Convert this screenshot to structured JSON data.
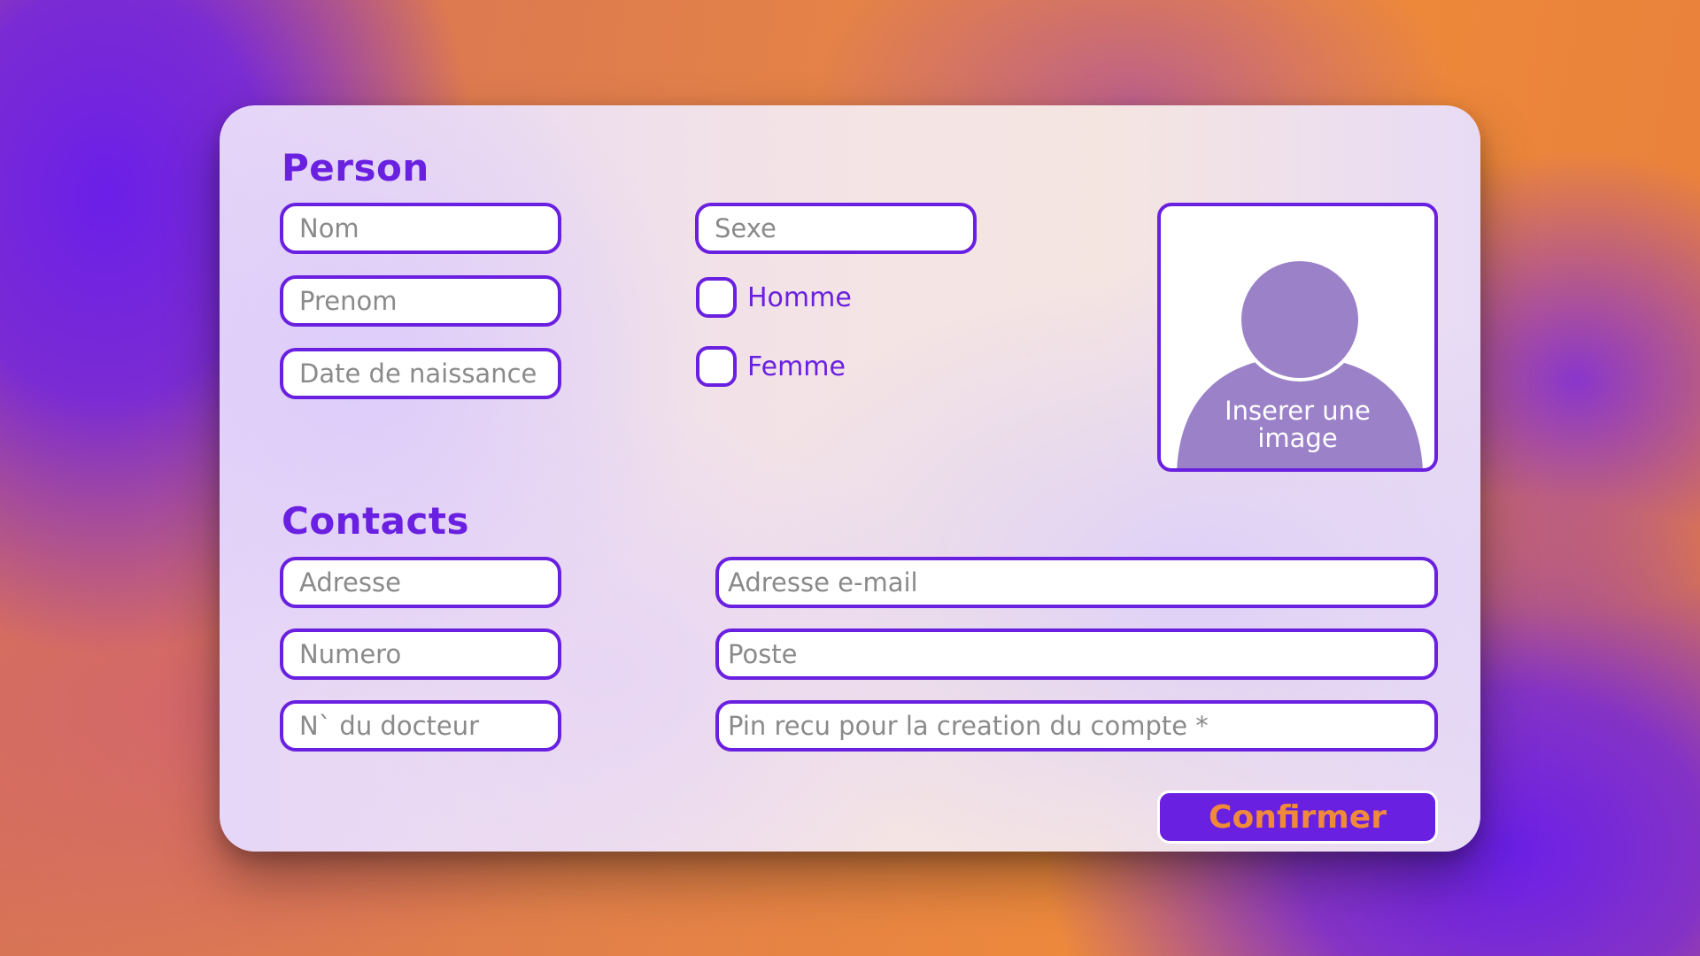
{
  "colors": {
    "accent": "#6a20e0",
    "button_text": "#f08a3a",
    "placeholder": "#8a8a8a",
    "avatar": "#9b82c8"
  },
  "person": {
    "title": "Person",
    "nom_placeholder": "Nom",
    "prenom_placeholder": "Prenom",
    "date_placeholder": "Date de naissance",
    "sexe_placeholder": "Sexe",
    "homme_label": "Homme",
    "femme_label": "Femme",
    "image_label_line1": "Inserer une",
    "image_label_line2": "image",
    "avatar_icon": "user-silhouette-icon"
  },
  "contacts": {
    "title": "Contacts",
    "adresse_placeholder": "Adresse",
    "numero_placeholder": "Numero",
    "docteur_placeholder": "N` du docteur",
    "email_placeholder": "Adresse e-mail",
    "poste_placeholder": "Poste",
    "pin_placeholder": "Pin recu pour la creation du compte *"
  },
  "actions": {
    "confirm_label": "Confirmer"
  }
}
